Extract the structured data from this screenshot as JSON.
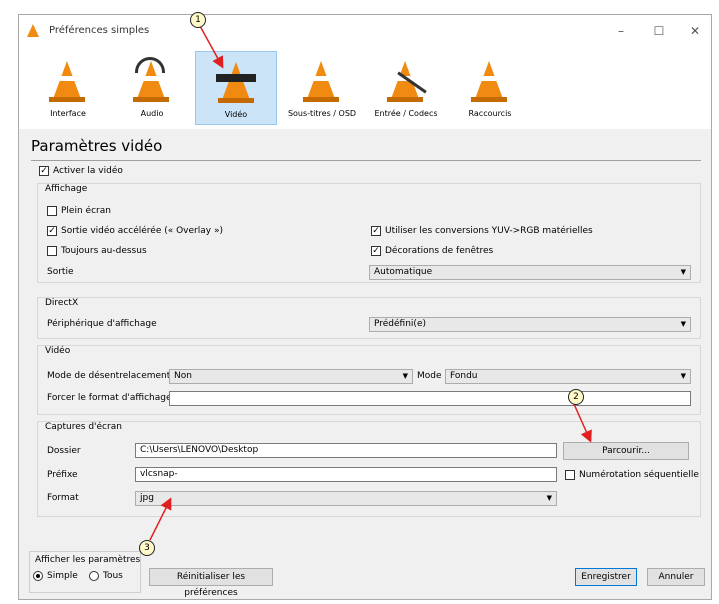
{
  "window": {
    "title": "Préférences simples"
  },
  "toolbar": {
    "items": [
      {
        "label": "Interface"
      },
      {
        "label": "Audio"
      },
      {
        "label": "Vidéo"
      },
      {
        "label": "Sous-titres / OSD"
      },
      {
        "label": "Entrée / Codecs"
      },
      {
        "label": "Raccourcis"
      }
    ]
  },
  "page": {
    "title": "Paramètres vidéo"
  },
  "video": {
    "enable_label": "Activer la vidéo",
    "display": {
      "title": "Affichage",
      "fullscreen": "Plein écran",
      "overlay": "Sortie vidéo accélérée (« Overlay »)",
      "always_on_top": "Toujours au-dessus",
      "yuv": "Utiliser les conversions YUV->RGB matérielles",
      "decorations": "Décorations de fenêtres",
      "output_label": "Sortie",
      "output_value": "Automatique"
    },
    "directx": {
      "title": "DirectX",
      "device_label": "Périphérique d'affichage",
      "device_value": "Prédéfini(e)"
    },
    "video_group": {
      "title": "Vidéo",
      "deinterlace_label": "Mode de désentrelacement",
      "deinterlace_value": "Non",
      "mode_label": "Mode",
      "mode_value": "Fondu",
      "force_label": "Forcer le format d'affichage",
      "force_value": ""
    },
    "snapshots": {
      "title": "Captures d'écran",
      "folder_label": "Dossier",
      "folder_value": "C:\\Users\\LENOVO\\Desktop",
      "browse_label": "Parcourir...",
      "prefix_label": "Préfixe",
      "prefix_value": "vlcsnap-",
      "sequential_label": "Numérotation séquentielle",
      "format_label": "Format",
      "format_value": "jpg"
    }
  },
  "footer": {
    "show_label": "Afficher les paramètres",
    "simple_label": "Simple",
    "all_label": "Tous",
    "reset_label": "Réinitialiser les préférences",
    "save_label": "Enregistrer",
    "cancel_label": "Annuler"
  },
  "annotations": {
    "m1": "1",
    "m2": "2",
    "m3": "3"
  },
  "colors": {
    "accent": "#0078d7",
    "selected_tab": "#cce4f7",
    "cone": "#f08a10",
    "arrow": "#e02020"
  }
}
